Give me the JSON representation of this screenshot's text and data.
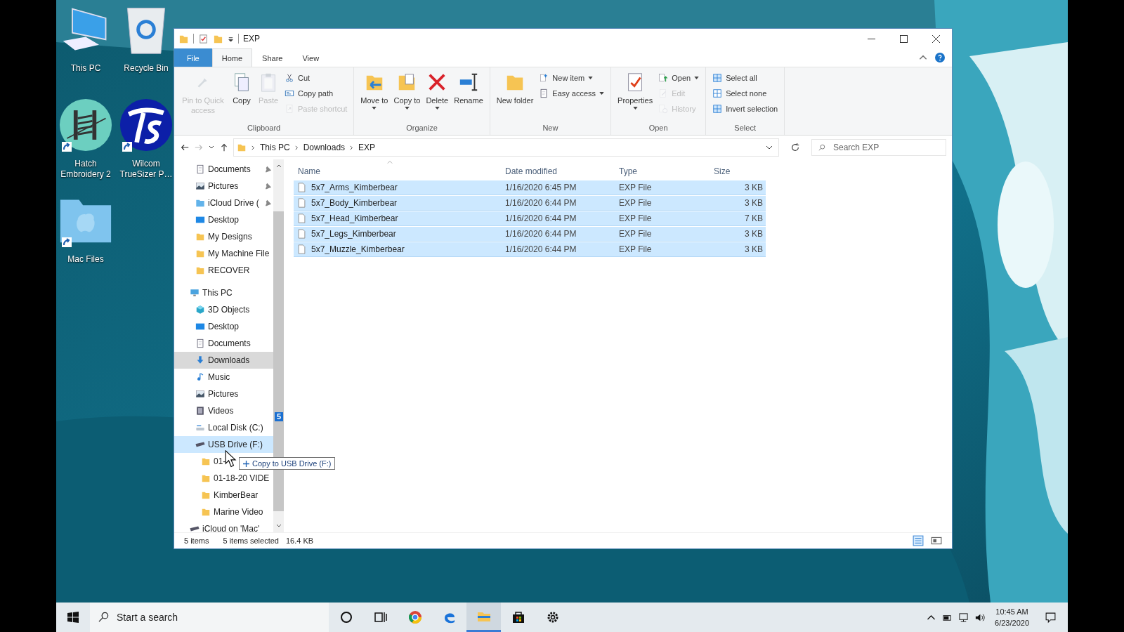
{
  "window": {
    "title": "EXP"
  },
  "ribbon": {
    "tabs": [
      {
        "label": "File",
        "kind": "file",
        "selected": false
      },
      {
        "label": "Home",
        "kind": "tab",
        "selected": true
      },
      {
        "label": "Share",
        "kind": "tab",
        "selected": false
      },
      {
        "label": "View",
        "kind": "tab",
        "selected": false
      }
    ],
    "groups": [
      {
        "label": "Clipboard",
        "large": [
          {
            "label": "Pin to Quick access",
            "kind": "pin",
            "disabled": true,
            "dropdown": false
          },
          {
            "label": "Copy",
            "kind": "copy",
            "disabled": false,
            "dropdown": false
          },
          {
            "label": "Paste",
            "kind": "paste",
            "disabled": true,
            "dropdown": false
          }
        ],
        "small": [
          {
            "label": "Cut",
            "kind": "cut",
            "disabled": false,
            "dropdown": false
          },
          {
            "label": "Copy path",
            "kind": "copypath",
            "disabled": false,
            "dropdown": false
          },
          {
            "label": "Paste shortcut",
            "kind": "pasteshortcut",
            "disabled": true,
            "dropdown": false
          }
        ]
      },
      {
        "label": "Organize",
        "large": [
          {
            "label": "Move to",
            "kind": "moveto",
            "disabled": false,
            "dropdown": true
          },
          {
            "label": "Copy to",
            "kind": "copyto",
            "disabled": false,
            "dropdown": true
          },
          {
            "label": "Delete",
            "kind": "delete",
            "disabled": false,
            "dropdown": true
          },
          {
            "label": "Rename",
            "kind": "rename",
            "disabled": false,
            "dropdown": false
          }
        ]
      },
      {
        "label": "New",
        "large": [
          {
            "label": "New folder",
            "kind": "newfolder",
            "disabled": false,
            "dropdown": false
          }
        ],
        "small": [
          {
            "label": "New item",
            "kind": "newitem",
            "disabled": false,
            "dropdown": true
          },
          {
            "label": "Easy access",
            "kind": "easyaccess",
            "disabled": false,
            "dropdown": true
          }
        ]
      },
      {
        "label": "Open",
        "large": [
          {
            "label": "Properties",
            "kind": "properties",
            "disabled": false,
            "dropdown": true
          }
        ],
        "small": [
          {
            "label": "Open",
            "kind": "open",
            "disabled": false,
            "dropdown": true
          },
          {
            "label": "Edit",
            "kind": "edit",
            "disabled": true,
            "dropdown": false
          },
          {
            "label": "History",
            "kind": "history",
            "disabled": true,
            "dropdown": false
          }
        ]
      },
      {
        "label": "Select",
        "small": [
          {
            "label": "Select all",
            "kind": "selectall",
            "disabled": false,
            "dropdown": false
          },
          {
            "label": "Select none",
            "kind": "selectnone",
            "disabled": false,
            "dropdown": false
          },
          {
            "label": "Invert selection",
            "kind": "invert",
            "disabled": false,
            "dropdown": false
          }
        ]
      }
    ]
  },
  "address": {
    "path": [
      "This PC",
      "Downloads",
      "EXP"
    ],
    "search_placeholder": "Search EXP"
  },
  "nav": {
    "quick_access": [
      {
        "label": "Documents",
        "kind": "doc",
        "pinned": true,
        "selected": false,
        "drop_target": false
      },
      {
        "label": "Pictures",
        "kind": "pictures",
        "pinned": true,
        "selected": false,
        "drop_target": false
      },
      {
        "label": "iCloud Drive (",
        "kind": "cloud",
        "pinned": true,
        "selected": false,
        "drop_target": false
      },
      {
        "label": "Desktop",
        "kind": "desktop",
        "pinned": false,
        "selected": false,
        "drop_target": false
      },
      {
        "label": "My Designs",
        "kind": "folder",
        "pinned": false,
        "selected": false,
        "drop_target": false
      },
      {
        "label": "My Machine File",
        "kind": "folder",
        "pinned": false,
        "selected": false,
        "drop_target": false
      },
      {
        "label": "RECOVER",
        "kind": "folder",
        "pinned": false,
        "selected": false,
        "drop_target": false
      }
    ],
    "tree": [
      {
        "label": "This PC",
        "kind": "pc",
        "selected": false,
        "drop_target": false,
        "children": [
          {
            "label": "3D Objects",
            "kind": "cube",
            "selected": false,
            "drop_target": false
          },
          {
            "label": "Desktop",
            "kind": "desktop",
            "selected": false,
            "drop_target": false
          },
          {
            "label": "Documents",
            "kind": "doc",
            "selected": false,
            "drop_target": false
          },
          {
            "label": "Downloads",
            "kind": "download",
            "selected": true,
            "drop_target": false
          },
          {
            "label": "Music",
            "kind": "music",
            "selected": false,
            "drop_target": false
          },
          {
            "label": "Pictures",
            "kind": "pictures",
            "selected": false,
            "drop_target": false
          },
          {
            "label": "Videos",
            "kind": "videos",
            "selected": false,
            "drop_target": false
          },
          {
            "label": "Local Disk (C:)",
            "kind": "disk",
            "selected": false,
            "drop_target": false
          },
          {
            "label": "USB Drive (F:)",
            "kind": "usb",
            "selected": false,
            "drop_target": true,
            "children": [
              {
                "label": "01-",
                "kind": "folder",
                "selected": false,
                "drop_target": false
              },
              {
                "label": "01-18-20 VIDE",
                "kind": "folder",
                "selected": false,
                "drop_target": false
              },
              {
                "label": "KimberBear",
                "kind": "folder",
                "selected": false,
                "drop_target": false
              },
              {
                "label": "Marine Video",
                "kind": "folder",
                "selected": false,
                "drop_target": false
              }
            ]
          }
        ]
      },
      {
        "label": "iCloud on 'Mac'",
        "kind": "usb",
        "selected": false,
        "drop_target": false
      }
    ]
  },
  "files": {
    "columns": [
      {
        "label": "Name",
        "sorted": true
      },
      {
        "label": "Date modified",
        "sorted": false
      },
      {
        "label": "Type",
        "sorted": false
      },
      {
        "label": "Size",
        "sorted": false
      }
    ],
    "rows": [
      {
        "name": "5x7_Arms_Kimberbear",
        "date": "1/16/2020 6:45 PM",
        "type": "EXP File",
        "size": "3 KB",
        "selected": true
      },
      {
        "name": "5x7_Body_Kimberbear",
        "date": "1/16/2020 6:44 PM",
        "type": "EXP File",
        "size": "3 KB",
        "selected": true
      },
      {
        "name": "5x7_Head_Kimberbear",
        "date": "1/16/2020 6:44 PM",
        "type": "EXP File",
        "size": "7 KB",
        "selected": true
      },
      {
        "name": "5x7_Legs_Kimberbear",
        "date": "1/16/2020 6:44 PM",
        "type": "EXP File",
        "size": "3 KB",
        "selected": true
      },
      {
        "name": "5x7_Muzzle_Kimberbear",
        "date": "1/16/2020 6:44 PM",
        "type": "EXP File",
        "size": "3 KB",
        "selected": true
      }
    ]
  },
  "status": {
    "count": "5 items",
    "selection": "5 items selected",
    "size": "16.4 KB"
  },
  "drag": {
    "badge": "5",
    "tooltip": "Copy to USB Drive (F:)"
  },
  "desktop": {
    "icons": [
      {
        "label": "This PC",
        "kind": "pc",
        "shortcut": false
      },
      {
        "label": "Recycle Bin",
        "kind": "bin",
        "shortcut": false
      },
      {
        "label": "Hatch Embroidery 2",
        "kind": "hatch",
        "shortcut": true
      },
      {
        "label": "Wilcom TrueSizer P…",
        "kind": "ts",
        "shortcut": true
      },
      {
        "label": "Mac Files",
        "kind": "macfolder",
        "shortcut": true
      }
    ]
  },
  "taskbar": {
    "search_placeholder": "Start a search",
    "apps": [
      {
        "kind": "cortana",
        "active": false
      },
      {
        "kind": "taskview",
        "active": false
      },
      {
        "kind": "chrome",
        "active": false
      },
      {
        "kind": "edge",
        "active": false
      },
      {
        "kind": "explorer",
        "active": true
      },
      {
        "kind": "store",
        "active": false
      },
      {
        "kind": "settings",
        "active": false
      }
    ],
    "time": "10:45 AM",
    "date": "6/23/2020"
  }
}
